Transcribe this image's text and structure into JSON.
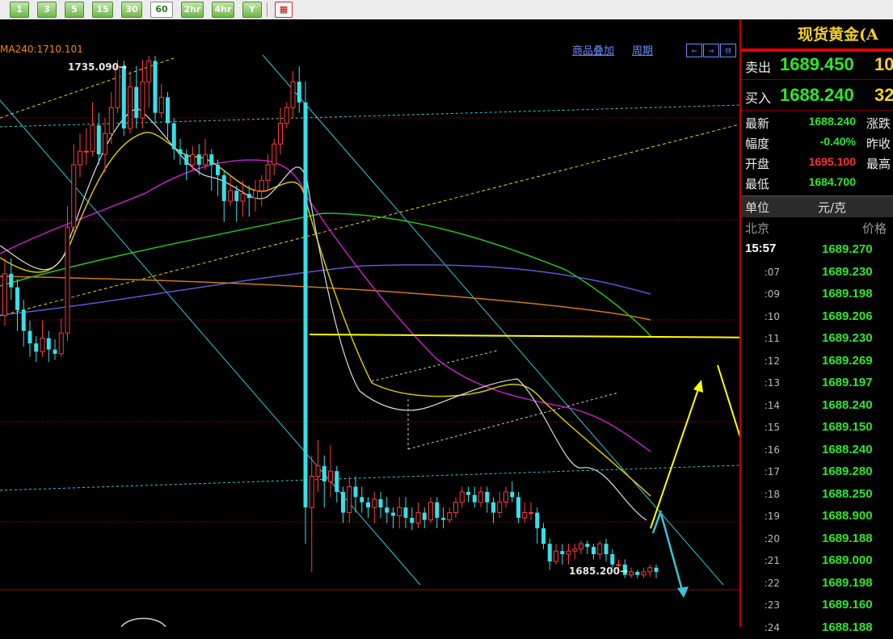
{
  "toolbar": {
    "periods": [
      "1",
      "3",
      "5",
      "15",
      "30",
      "60",
      "2hr",
      "4hr",
      "Y"
    ],
    "active_period": "60"
  },
  "chart": {
    "ma_label": "MA240:1710.101",
    "high_label": "1735.090→",
    "low_label": "1685.200→",
    "links": [
      "商品叠加",
      "周期"
    ],
    "nav_icons": [
      "⇐",
      "⇒",
      "⊟"
    ]
  },
  "panel": {
    "title": "现货黄金(A",
    "sell_label": "卖出",
    "sell_price": "1689.450",
    "sell_vol": "10",
    "buy_label": "买入",
    "buy_price": "1688.240",
    "buy_vol": "32",
    "stats": [
      {
        "label": "最新",
        "value": "1688.240",
        "color": "#2ee62e",
        "label2": "涨跌"
      },
      {
        "label": "幅度",
        "value": "-0.40%",
        "color": "#2ee62e",
        "label2": "昨收"
      },
      {
        "label": "开盘",
        "value": "1695.100",
        "color": "#ff3030",
        "label2": "最高"
      },
      {
        "label": "最低",
        "value": "1684.700",
        "color": "#2ee62e",
        "label2": ""
      }
    ],
    "unit_label": "单位",
    "unit_value": "元/克",
    "tick_header_left": "北京",
    "tick_header_right": "价格",
    "ticks": [
      {
        "time": "15:57",
        "price": "1689.270"
      },
      {
        "time": ":07",
        "price": "1689.230"
      },
      {
        "time": ":09",
        "price": "1689.198"
      },
      {
        "time": ":10",
        "price": "1689.206"
      },
      {
        "time": ":11",
        "price": "1689.230"
      },
      {
        "time": ":12",
        "price": "1689.269"
      },
      {
        "time": ":13",
        "price": "1689.197"
      },
      {
        "time": ":14",
        "price": "1688.240"
      },
      {
        "time": ":15",
        "price": "1689.150"
      },
      {
        "time": ":16",
        "price": "1688.240"
      },
      {
        "time": ":17",
        "price": "1689.280"
      },
      {
        "time": ":18",
        "price": "1688.250"
      },
      {
        "time": ":19",
        "price": "1688.900"
      },
      {
        "time": ":20",
        "price": "1689.188"
      },
      {
        "time": ":21",
        "price": "1689.000"
      },
      {
        "time": ":22",
        "price": "1689.198"
      },
      {
        "time": ":23",
        "price": "1689.160"
      },
      {
        "time": ":24",
        "price": "1688.188"
      }
    ]
  },
  "chart_data": {
    "type": "candlestick",
    "symbol": "现货黄金",
    "period": "60",
    "high_marker": 1735.09,
    "low_marker": 1685.2,
    "ma240": 1710.101,
    "candles": [
      [
        1710.5,
        1714.5,
        1716.0,
        1709.5
      ],
      [
        1714.5,
        1713.2,
        1716.0,
        1712.0
      ],
      [
        1713.2,
        1711.0,
        1714.0,
        1709.0
      ],
      [
        1711.0,
        1709.0,
        1712.0,
        1707.5
      ],
      [
        1709.0,
        1707.8,
        1710.0,
        1706.5
      ],
      [
        1707.8,
        1707.0,
        1708.5,
        1706.0
      ],
      [
        1707.0,
        1708.3,
        1710.0,
        1706.5
      ],
      [
        1708.3,
        1707.2,
        1709.0,
        1706.0
      ],
      [
        1707.2,
        1706.8,
        1708.2,
        1706.2
      ],
      [
        1706.8,
        1708.8,
        1710.2,
        1706.5
      ],
      [
        1708.8,
        1719.0,
        1721.0,
        1708.0
      ],
      [
        1719.0,
        1725.0,
        1727.0,
        1718.5
      ],
      [
        1725.0,
        1726.3,
        1728.0,
        1723.8
      ],
      [
        1726.3,
        1726.3,
        1728.5,
        1725.0
      ],
      [
        1726.3,
        1728.8,
        1731.0,
        1725.8
      ],
      [
        1728.8,
        1726.0,
        1730.0,
        1725.0
      ],
      [
        1726.0,
        1728.0,
        1729.5,
        1724.2
      ],
      [
        1728.0,
        1730.5,
        1732.0,
        1727.0
      ],
      [
        1730.5,
        1734.5,
        1735.1,
        1730.0
      ],
      [
        1734.5,
        1728.5,
        1735.0,
        1727.8
      ],
      [
        1728.5,
        1732.5,
        1734.0,
        1728.0
      ],
      [
        1732.5,
        1729.5,
        1734.5,
        1728.5
      ],
      [
        1729.5,
        1733.0,
        1735.09,
        1728.5
      ],
      [
        1733.0,
        1735.0,
        1735.5,
        1730.5
      ],
      [
        1735.0,
        1730.0,
        1735.5,
        1729.0
      ],
      [
        1730.0,
        1731.5,
        1732.8,
        1729.5
      ],
      [
        1731.5,
        1729.0,
        1732.0,
        1727.5
      ],
      [
        1729.0,
        1726.5,
        1729.5,
        1725.5
      ],
      [
        1726.5,
        1726.0,
        1727.5,
        1725.0
      ],
      [
        1726.0,
        1725.0,
        1726.5,
        1723.5
      ],
      [
        1725.0,
        1726.0,
        1726.8,
        1724.5
      ],
      [
        1726.0,
        1725.0,
        1727.0,
        1724.0
      ],
      [
        1725.0,
        1726.0,
        1727.5,
        1724.5
      ],
      [
        1726.0,
        1725.0,
        1726.5,
        1722.5
      ],
      [
        1725.0,
        1724.0,
        1725.5,
        1722.0
      ],
      [
        1724.0,
        1721.5,
        1724.5,
        1719.5
      ],
      [
        1721.5,
        1722.5,
        1724.0,
        1721.0
      ],
      [
        1722.5,
        1721.5,
        1723.0,
        1719.5
      ],
      [
        1721.5,
        1722.2,
        1723.5,
        1720.0
      ],
      [
        1722.2,
        1721.8,
        1723.0,
        1720.0
      ],
      [
        1721.8,
        1722.5,
        1723.5,
        1720.5
      ],
      [
        1722.5,
        1723.5,
        1724.0,
        1721.0
      ],
      [
        1723.5,
        1725.0,
        1726.0,
        1722.5
      ],
      [
        1725.0,
        1727.0,
        1727.5,
        1724.0
      ],
      [
        1727.0,
        1729.0,
        1730.5,
        1726.0
      ],
      [
        1729.0,
        1730.5,
        1731.0,
        1728.5
      ],
      [
        1730.5,
        1733.0,
        1734.0,
        1729.5
      ],
      [
        1733.0,
        1731.0,
        1734.5,
        1730.0
      ],
      [
        1731.0,
        1692.0,
        1733.0,
        1688.5
      ],
      [
        1692.0,
        1695.0,
        1697.0,
        1685.8
      ],
      [
        1695.0,
        1696.0,
        1698.5,
        1693.5
      ],
      [
        1696.0,
        1694.5,
        1697.0,
        1692.0
      ],
      [
        1694.5,
        1695.5,
        1698.0,
        1693.0
      ],
      [
        1695.5,
        1693.5,
        1696.0,
        1692.5
      ],
      [
        1693.5,
        1691.5,
        1694.0,
        1690.5
      ],
      [
        1691.5,
        1694.0,
        1695.0,
        1690.5
      ],
      [
        1694.0,
        1693.0,
        1695.0,
        1691.5
      ],
      [
        1693.0,
        1692.5,
        1694.0,
        1691.5
      ],
      [
        1692.5,
        1692.0,
        1693.0,
        1691.0
      ],
      [
        1692.0,
        1692.8,
        1693.5,
        1690.5
      ],
      [
        1692.8,
        1692.0,
        1693.5,
        1691.0
      ],
      [
        1692.0,
        1691.5,
        1693.0,
        1690.5
      ],
      [
        1691.5,
        1691.2,
        1692.0,
        1690.0
      ],
      [
        1691.2,
        1692.0,
        1693.0,
        1690.0
      ],
      [
        1692.0,
        1691.0,
        1693.0,
        1690.0
      ],
      [
        1691.0,
        1690.5,
        1692.0,
        1689.8
      ],
      [
        1690.5,
        1691.5,
        1692.5,
        1690.0
      ],
      [
        1691.5,
        1690.8,
        1692.0,
        1690.0
      ],
      [
        1690.8,
        1692.5,
        1693.0,
        1690.5
      ],
      [
        1692.5,
        1691.0,
        1693.0,
        1690.0
      ],
      [
        1691.0,
        1690.8,
        1692.0,
        1690.0
      ],
      [
        1690.8,
        1691.5,
        1692.0,
        1690.5
      ],
      [
        1691.5,
        1692.5,
        1693.0,
        1691.0
      ],
      [
        1692.5,
        1693.5,
        1694.0,
        1692.0
      ],
      [
        1693.5,
        1693.2,
        1694.0,
        1692.5
      ],
      [
        1693.2,
        1692.5,
        1694.0,
        1692.0
      ],
      [
        1692.5,
        1693.5,
        1694.0,
        1692.0
      ],
      [
        1693.5,
        1692.5,
        1694.0,
        1691.5
      ],
      [
        1692.5,
        1691.5,
        1693.0,
        1690.5
      ],
      [
        1691.5,
        1692.5,
        1693.5,
        1691.0
      ],
      [
        1692.5,
        1693.5,
        1694.0,
        1692.0
      ],
      [
        1693.5,
        1693.0,
        1694.5,
        1692.5
      ],
      [
        1693.0,
        1691.0,
        1693.5,
        1690.5
      ],
      [
        1691.0,
        1691.5,
        1692.5,
        1690.5
      ],
      [
        1691.5,
        1691.5,
        1692.5,
        1690.8
      ],
      [
        1691.5,
        1690.0,
        1692.0,
        1688.5
      ],
      [
        1690.0,
        1688.5,
        1690.5,
        1688.0
      ],
      [
        1688.5,
        1686.8,
        1689.0,
        1686.0
      ],
      [
        1686.8,
        1687.8,
        1688.5,
        1686.5
      ],
      [
        1687.8,
        1687.5,
        1688.5,
        1686.5
      ],
      [
        1687.5,
        1687.8,
        1688.5,
        1686.5
      ],
      [
        1687.8,
        1688.0,
        1688.5,
        1687.0
      ],
      [
        1688.0,
        1688.5,
        1688.8,
        1687.5
      ],
      [
        1688.5,
        1688.2,
        1688.8,
        1687.5
      ],
      [
        1688.2,
        1687.5,
        1688.5,
        1687.0
      ],
      [
        1687.5,
        1688.5,
        1688.8,
        1687.0
      ],
      [
        1688.5,
        1687.5,
        1689.0,
        1686.8
      ],
      [
        1687.5,
        1686.5,
        1688.0,
        1686.2
      ],
      [
        1686.5,
        1686.5,
        1687.0,
        1685.8
      ],
      [
        1686.5,
        1685.5,
        1687.0,
        1685.2
      ],
      [
        1685.5,
        1685.8,
        1686.2,
        1685.2
      ],
      [
        1685.8,
        1685.5,
        1686.0,
        1685.2
      ],
      [
        1685.5,
        1685.8,
        1686.2,
        1685.2
      ],
      [
        1685.8,
        1686.2,
        1686.5,
        1685.3
      ],
      [
        1686.2,
        1685.8,
        1686.5,
        1685.2
      ]
    ]
  }
}
